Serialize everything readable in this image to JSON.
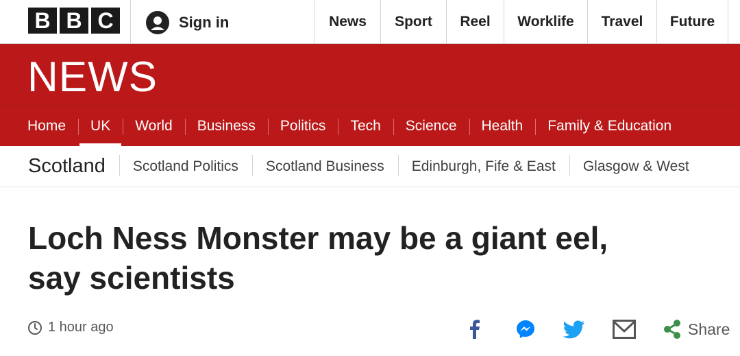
{
  "brand": {
    "letters": [
      "B",
      "B",
      "C"
    ],
    "section_banner": "NEWS"
  },
  "account": {
    "signin_label": "Sign in"
  },
  "top_nav": [
    "News",
    "Sport",
    "Reel",
    "Worklife",
    "Travel",
    "Future"
  ],
  "main_nav": {
    "items": [
      "Home",
      "UK",
      "World",
      "Business",
      "Politics",
      "Tech",
      "Science",
      "Health",
      "Family & Education"
    ],
    "active": "UK"
  },
  "sub_nav": {
    "section": "Scotland",
    "items": [
      "Scotland Politics",
      "Scotland Business",
      "Edinburgh, Fife & East",
      "Glasgow & West"
    ]
  },
  "article": {
    "headline_line1": "Loch Ness Monster may be a giant eel,",
    "headline_line2": "say scientists",
    "timestamp": "1 hour ago"
  },
  "share": {
    "label": "Share",
    "icons": [
      "facebook-icon",
      "messenger-icon",
      "twitter-icon",
      "email-icon",
      "share-icon"
    ]
  },
  "colors": {
    "brand_red": "#bb1919",
    "facebook": "#3b5998",
    "messenger": "#0084ff",
    "twitter": "#1da1f2",
    "share_green": "#3d8f4a"
  }
}
